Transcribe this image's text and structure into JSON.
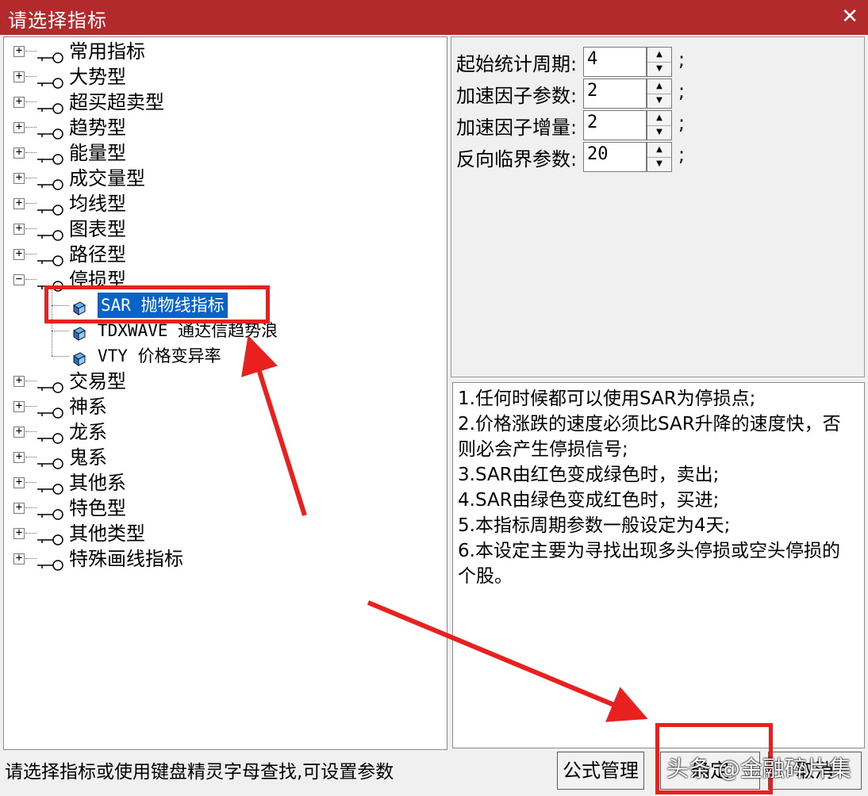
{
  "window": {
    "title": "请选择指标",
    "close_glyph": "✕"
  },
  "tree": {
    "groups_top": [
      {
        "label": "常用指标",
        "expander": "+"
      },
      {
        "label": "大势型",
        "expander": "+"
      },
      {
        "label": "超买超卖型",
        "expander": "+"
      },
      {
        "label": "趋势型",
        "expander": "+"
      },
      {
        "label": "能量型",
        "expander": "+"
      },
      {
        "label": "成交量型",
        "expander": "+"
      },
      {
        "label": "均线型",
        "expander": "+"
      },
      {
        "label": "图表型",
        "expander": "+"
      },
      {
        "label": "路径型",
        "expander": "+"
      },
      {
        "label": "停损型",
        "expander": "−"
      }
    ],
    "children": [
      {
        "label": "SAR 抛物线指标",
        "selected": true
      },
      {
        "label": "TDXWAVE 通达信趋势浪",
        "selected": false
      },
      {
        "label": "VTY 价格变异率",
        "selected": false
      }
    ],
    "groups_bottom": [
      {
        "label": "交易型",
        "expander": "+"
      },
      {
        "label": "神系",
        "expander": "+"
      },
      {
        "label": "龙系",
        "expander": "+"
      },
      {
        "label": "鬼系",
        "expander": "+"
      },
      {
        "label": "其他系",
        "expander": "+"
      },
      {
        "label": "特色型",
        "expander": "+"
      },
      {
        "label": "其他类型",
        "expander": "+"
      },
      {
        "label": "特殊画线指标",
        "expander": "+"
      }
    ]
  },
  "params": [
    {
      "label": "起始统计周期:",
      "value": "4"
    },
    {
      "label": "加速因子参数:",
      "value": "2"
    },
    {
      "label": "加速因子增量:",
      "value": "2"
    },
    {
      "label": "反向临界参数:",
      "value": "20"
    }
  ],
  "param_separator": ";",
  "description": [
    "1.任何时候都可以使用SAR为停损点;",
    "2.价格涨跌的速度必须比SAR升降的速度快，否",
    "则必会产生停损信号;",
    "3.SAR由红色变成绿色时，卖出;",
    "4.SAR由绿色变成红色时，买进;",
    "5.本指标周期参数一般设定为4天;",
    "6.本设定主要为寻找出现多头停损或空头停损的",
    "个股。"
  ],
  "status_text": "请选择指标或使用键盘精灵字母查找,可设置参数",
  "buttons": {
    "formula": "公式管理",
    "ok": "确定",
    "cancel": "取消"
  },
  "watermark": "头条 @金融碎片集",
  "colors": {
    "titlebar": "#b32a2d",
    "selection": "#0a64c8",
    "annotation": "#e8201e"
  }
}
